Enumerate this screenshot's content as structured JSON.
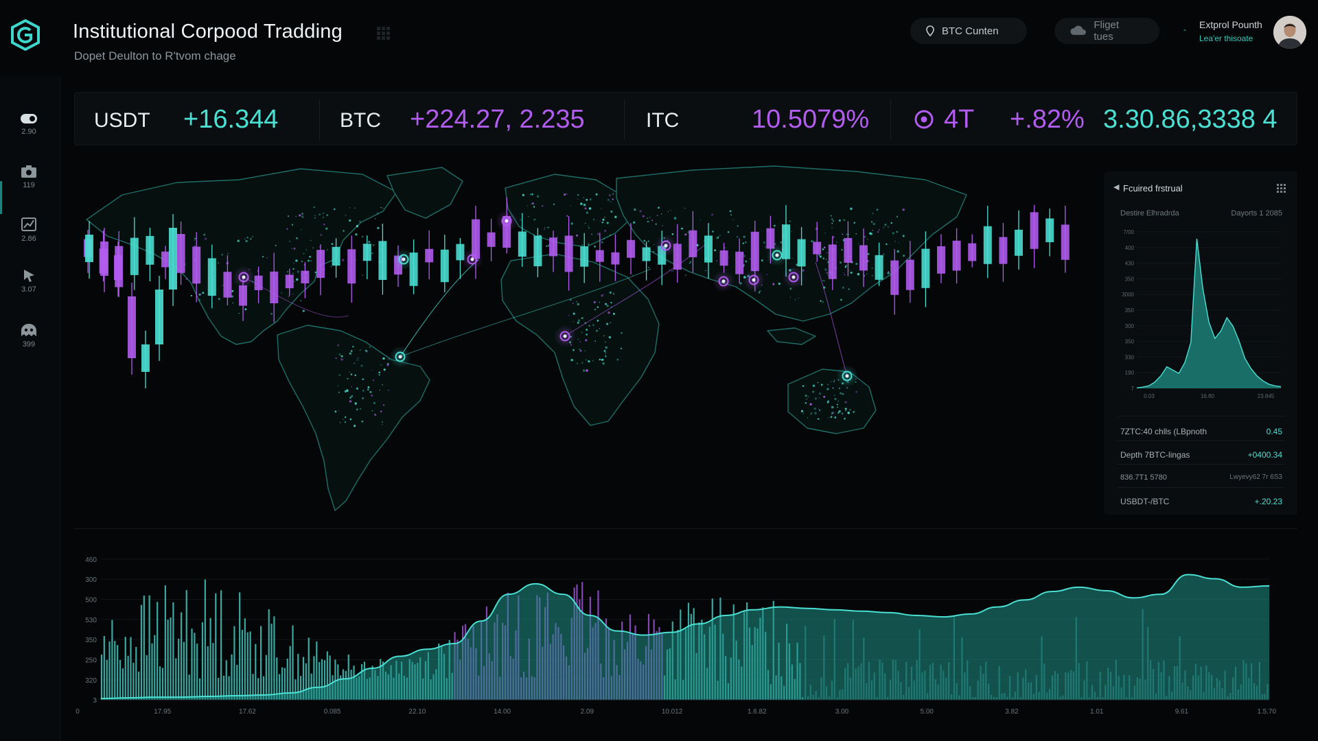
{
  "header": {
    "title": "Institutional Corpood Tradding",
    "subtitle": "Dopet Deulton to R'tvom chage",
    "btc_pill": "BTC Cunten",
    "figures_pill": "Fliget tues",
    "user_name": "Extprol Pounth",
    "user_sub": "Lea'er thisoate",
    "user_dash": "-"
  },
  "rail": [
    {
      "icon": "toggle-icon",
      "value": "2.90"
    },
    {
      "icon": "camera-icon",
      "value": "119"
    },
    {
      "icon": "chart-icon",
      "value": "2.86"
    },
    {
      "icon": "cursor-icon",
      "value": "3.07"
    },
    {
      "icon": "alien-icon",
      "value": "399"
    }
  ],
  "ticker": [
    {
      "label": "USDT",
      "value": "+16.344"
    },
    {
      "label": "BTC",
      "value": "+224.27, 2.235"
    },
    {
      "label": "ITC",
      "value": "10.5079%"
    },
    {
      "label": "4T",
      "value": "+.82%"
    },
    {
      "label": "",
      "value": "3.30.86,3338 4"
    }
  ],
  "colors": {
    "cyan": "#4be0d4",
    "purple": "#b35cf0",
    "teal_fill": "#1f8f86",
    "background": "#050608"
  },
  "right_panel": {
    "title": "Fcuired frstrual",
    "header_left": "Destire Elhradrda",
    "header_right": "Dayorts 1 2085",
    "rows": [
      {
        "label": "7ZTC:40 chlls (LBpnoth",
        "value": "0.45"
      },
      {
        "label": "Depth 7BTC-lingas",
        "value": "+0400.34"
      },
      {
        "label": "836.7T1 5780",
        "value": "Lwyevy62 7r 6S3"
      },
      {
        "label": "USBDT-/BTC",
        "value": "+.20.23"
      }
    ]
  },
  "chart_data": [
    {
      "type": "area",
      "title": "",
      "y_ticks": [
        "7/00",
        "400",
        "430",
        "350",
        "3000",
        "350",
        "300",
        "350",
        "330",
        "190",
        "7"
      ],
      "x_ticks": [
        "0.03",
        "16.80",
        "23.845"
      ],
      "series": [
        {
          "values": [
            1,
            3,
            6,
            15,
            30,
            52,
            44,
            36,
            62,
            110,
            360,
            240,
            160,
            120,
            138,
            170,
            150,
            115,
            72,
            48,
            30,
            18,
            10,
            6,
            4
          ]
        }
      ]
    },
    {
      "type": "bar",
      "title": "",
      "y_ticks": [
        "460",
        "300",
        "500",
        "530",
        "350",
        "250",
        "320",
        "3"
      ],
      "x_ticks": [
        "0",
        "17.95",
        "17.62",
        "0.085",
        "22.10",
        "14.00",
        "2.09",
        "10.012",
        "1.6.82",
        "3.00",
        "5.00",
        "3.82",
        "1.01",
        "9.61",
        "1.5.70"
      ],
      "overlay_area": [
        2,
        3,
        4,
        4,
        5,
        6,
        7,
        10,
        18,
        30,
        45,
        62,
        72,
        80,
        112,
        150,
        165,
        150,
        120,
        98,
        92,
        96,
        108,
        120,
        128,
        132,
        130,
        128,
        126,
        124,
        120,
        118,
        122,
        132,
        142,
        154,
        160,
        155,
        145,
        150,
        178,
        172,
        160,
        162
      ]
    }
  ]
}
